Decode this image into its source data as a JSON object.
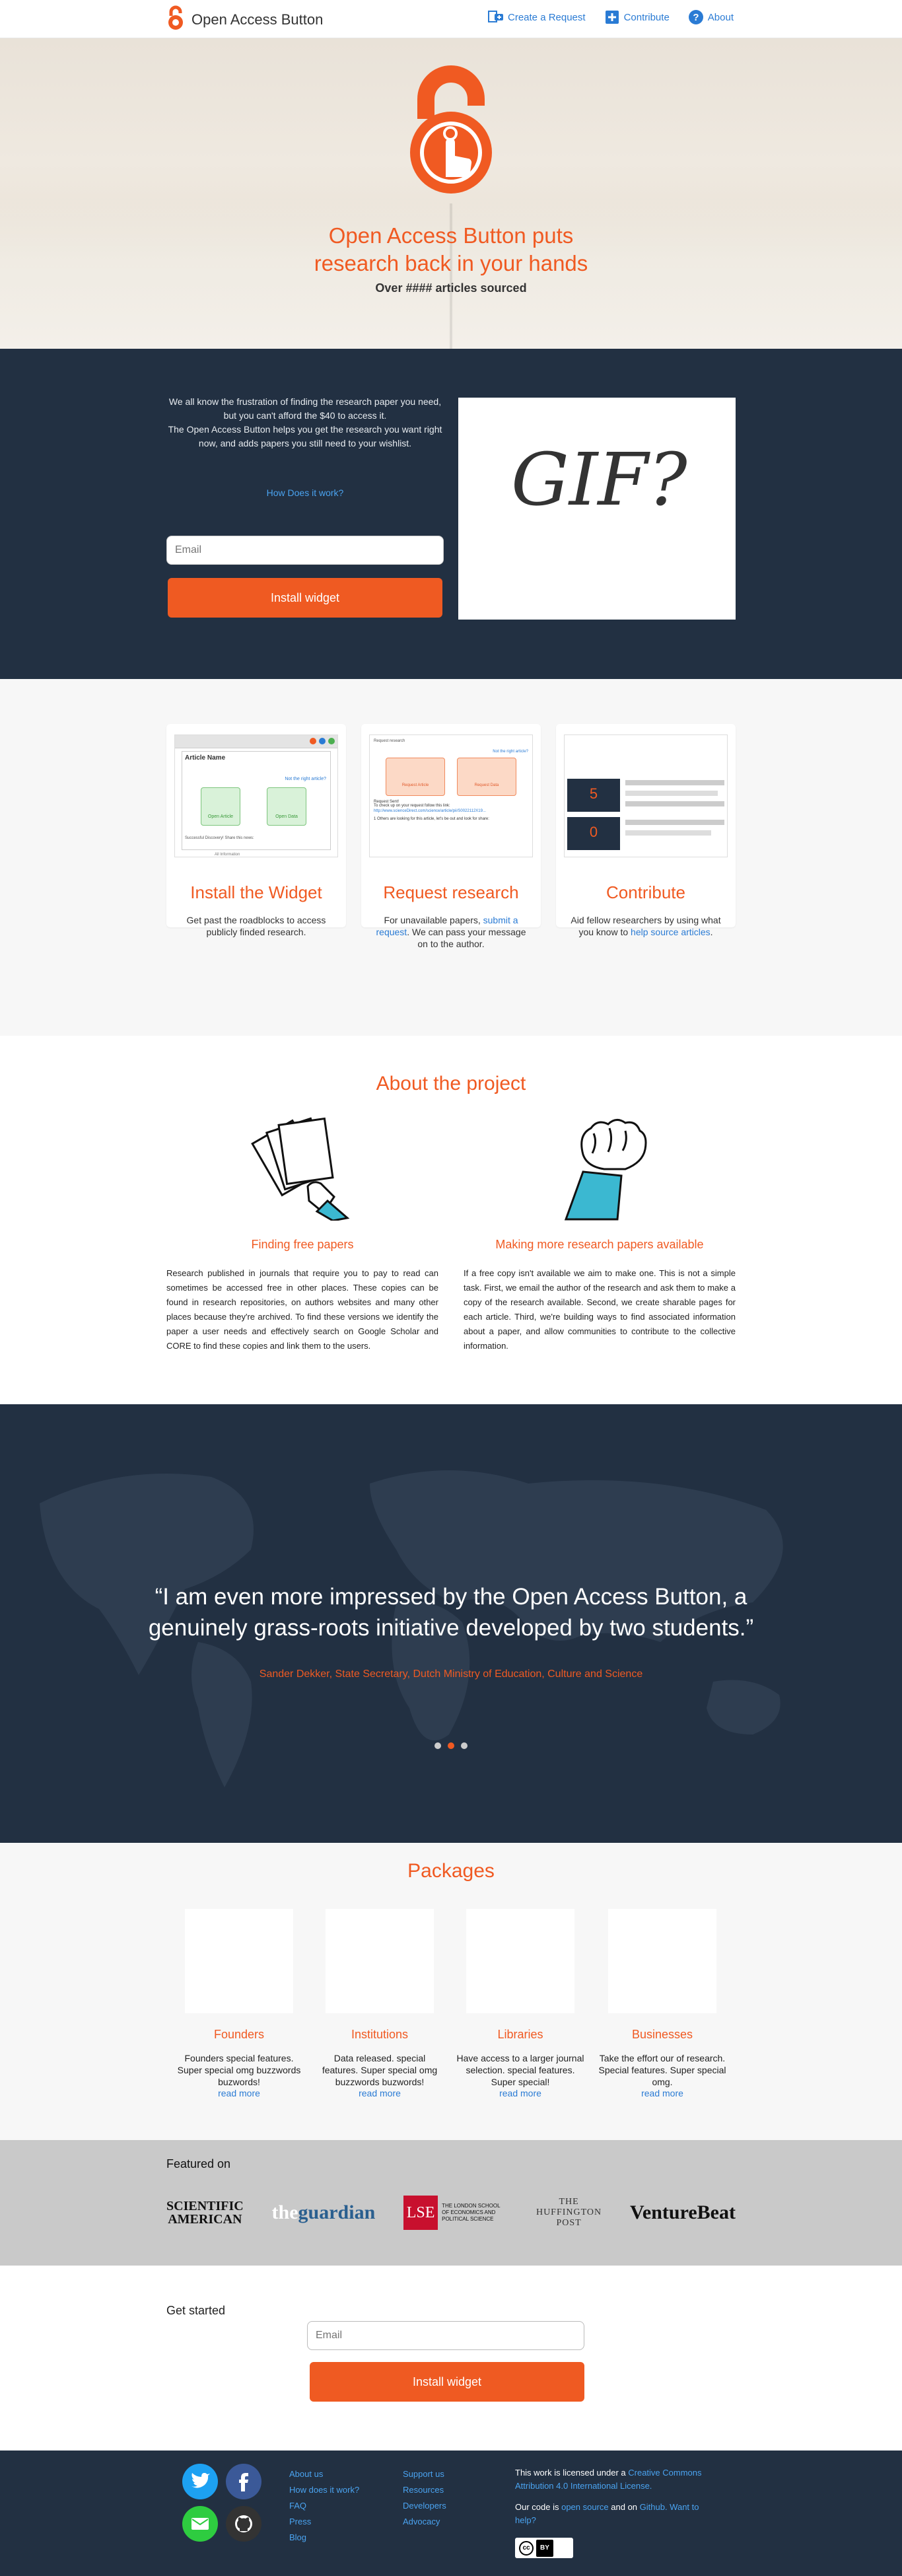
{
  "header": {
    "brand": "Open Access Button",
    "nav": [
      {
        "label": "Create a Request",
        "icon": "request-icon"
      },
      {
        "label": "Contribute",
        "icon": "plus-icon"
      },
      {
        "label": "About",
        "icon": "question-icon"
      }
    ]
  },
  "hero": {
    "title_line1": "Open Access Button puts",
    "title_line2": "research back in your hands",
    "subtitle": "Over #### articles sourced"
  },
  "intro": {
    "line1": "We all know the frustration of finding the research paper you need, but you can't afford the $40 to access it.",
    "line2": "The Open Access Button helps you get the research you want right now, and adds papers you still need to your wishlist.",
    "how_link": "How Does it work?",
    "email_placeholder": "Email",
    "install_label": "Install widget",
    "gif_text": "GIF?"
  },
  "features": [
    {
      "title": "Install the Widget",
      "desc": "Get past the roadblocks to access publicly finded research."
    },
    {
      "title": "Request research",
      "desc_pre": "For unavailable papers, ",
      "desc_link": "submit a request",
      "desc_post": ". We can pass your message on to the author."
    },
    {
      "title": "Contribute",
      "desc_pre": "Aid fellow researchers by using what you know to ",
      "desc_link": "help source articles",
      "desc_post": "."
    }
  ],
  "widget_mock": {
    "article_name": "Article Name",
    "not_right": "Not the right article?",
    "btn_article": "Open Article",
    "btn_data": "Open Data",
    "share": "Successful Discovery! Share this news:",
    "footer": "All Information"
  },
  "request_mock": {
    "label": "Request research",
    "not_right": "Not the right article?",
    "btn_article": "Request Article",
    "btn_data": "Request Data",
    "sent": "Request Sent!",
    "track": "To check up on your request follow this link:",
    "link": "http://www.scienceDirect.com/science/article/pii/S0022112X19...",
    "others": "1 Others are looking for this article, let's be out and look for share:"
  },
  "contribute_mock": {
    "count1": "5",
    "count2": "0"
  },
  "about": {
    "heading": "About the project",
    "col1_title": "Finding free papers",
    "col1_body": "Research published in journals that require you to pay to read can sometimes be accessed free in other places. These copies can be found in research repositories, on authors websites and many other places because they're archived. To find these versions we identify the paper a user needs and effectively search on Google Scholar and CORE to find these copies and link them to the users.",
    "col2_title": "Making more research papers available",
    "col2_body": "If a free copy isn't available we aim to make one. This is not a simple task. First, we email the author of the research and ask them to make a copy of the research available. Second, we create sharable pages for each article. Third, we're building ways to find associated information about a paper, and allow communities to contribute to the collective information."
  },
  "quote": {
    "text": "“I am even more impressed by the Open Access Button, a genuinely grass-roots initiative developed by two students.”",
    "author": "Sander Dekker, State Secretary, Dutch Ministry of Education, Culture and Science"
  },
  "packages": {
    "heading": "Packages",
    "items": [
      {
        "title": "Founders",
        "desc": "Founders special features. Super special omg buzzwords buzwords!",
        "more": "read more"
      },
      {
        "title": "Institutions",
        "desc": "Data released. special features. Super special omg buzzwords buzwords!",
        "more": "read more"
      },
      {
        "title": "Libraries",
        "desc": "Have access to a larger journal selection. special features. Super special!",
        "more": "read more"
      },
      {
        "title": "Businesses",
        "desc": "Take the effort our of research. Special features. Super special omg.",
        "more": "read more"
      }
    ]
  },
  "featured": {
    "heading": "Featured on",
    "logos": {
      "sciam1": "SCIENTIFIC",
      "sciam2": "AMERICAN",
      "guardian_the": "the",
      "guardian_name": "guardian",
      "lse_mark": "LSE",
      "lse_text": "THE LONDON SCHOOL OF ECONOMICS AND POLITICAL SCIENCE",
      "huff1": "THE",
      "huff2": "HUFFINGTON",
      "huff3": "POST",
      "vb": "VentureBeat"
    }
  },
  "get_started": {
    "heading": "Get started",
    "email_placeholder": "Email",
    "install_label": "Install widget"
  },
  "footer": {
    "col1": [
      "About us",
      "How does it work?",
      "FAQ",
      "Press",
      "Blog"
    ],
    "col2": [
      "Support us",
      "Resources",
      "Developers",
      "Advocacy"
    ],
    "license_pre": "This work is licensed under a ",
    "license_link": "Creative Commons Attribution 4.0 International License.",
    "code_pre": "Our code is ",
    "code_link1": "open source",
    "code_mid": " and on ",
    "code_link2": "Github. Want to help?",
    "cc_badge": "cc",
    "cc_by": "BY"
  },
  "colors": {
    "accent": "#f05a22",
    "navy": "#223042",
    "link": "#2a7bd4"
  }
}
